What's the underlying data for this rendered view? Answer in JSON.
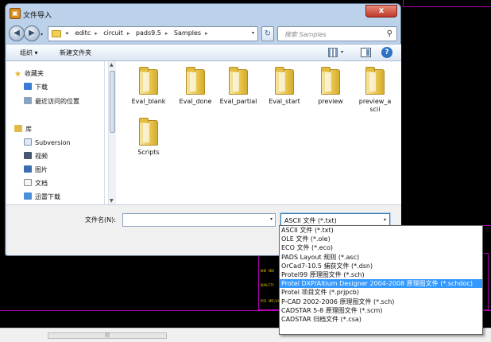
{
  "window": {
    "title": "文件导入",
    "close_label": "x"
  },
  "navigation": {
    "breadcrumb": [
      "«",
      "editc",
      "circuit",
      "pads9.5",
      "Samples"
    ],
    "search_placeholder": "搜索 Samples"
  },
  "toolbar": {
    "organize_label": "组织 ▾",
    "new_folder_label": "新建文件夹"
  },
  "sidebar": {
    "items": [
      {
        "label": "收藏夹",
        "icon": "star-icon"
      },
      {
        "label": "下载",
        "icon": "download-folder-icon"
      },
      {
        "label": "最近访问的位置",
        "icon": "recent-places-icon"
      },
      {
        "label": "库",
        "icon": "library-icon"
      },
      {
        "label": "Subversion",
        "icon": "document-library-icon"
      },
      {
        "label": "视频",
        "icon": "video-icon"
      },
      {
        "label": "图片",
        "icon": "picture-icon"
      },
      {
        "label": "文档",
        "icon": "document-icon"
      },
      {
        "label": "迅雷下载",
        "icon": "thunder-download-icon"
      }
    ]
  },
  "files": [
    {
      "name": "Eval_blank"
    },
    {
      "name": "Eval_done"
    },
    {
      "name": "Eval_partial"
    },
    {
      "name": "Eval_start"
    },
    {
      "name": "preview"
    },
    {
      "name": "preview_ascii"
    },
    {
      "name": "Scripts"
    }
  ],
  "footer": {
    "filename_label": "文件名(N):",
    "filename_value": "",
    "filetype_value": "ASCII 文件 (*.txt)"
  },
  "filetype_options": [
    "ASCII 文件 (*.txt)",
    "OLE 文件 (*.ole)",
    "ECO 文件 (*.eco)",
    "PADS Layout 规则 (*.asc)",
    "OrCad7-10.5 捕获文件 (*.dsn)",
    "Protel99 原理图文件 (*.sch)",
    "Protel DXP/Altium Designer 2004-2008 原理图文件 (*.schdoc)",
    "Protel 项目文件 (*.prjpcb)",
    "P-CAD 2002-2006 原理图文件 (*.sch)",
    "CADSTAR 5-8 原理图文件 (*.scm)",
    "CADSTAR 归档文件 (*.csa)"
  ],
  "selected_option_index": 6,
  "background_tags": [
    "OHE VDD",
    "QUALITY",
    "PCE 4MF/4A"
  ],
  "colors": {
    "selection": "#3399ff",
    "background_border": "#b000b0",
    "window_frame": "#bcd2ea"
  }
}
